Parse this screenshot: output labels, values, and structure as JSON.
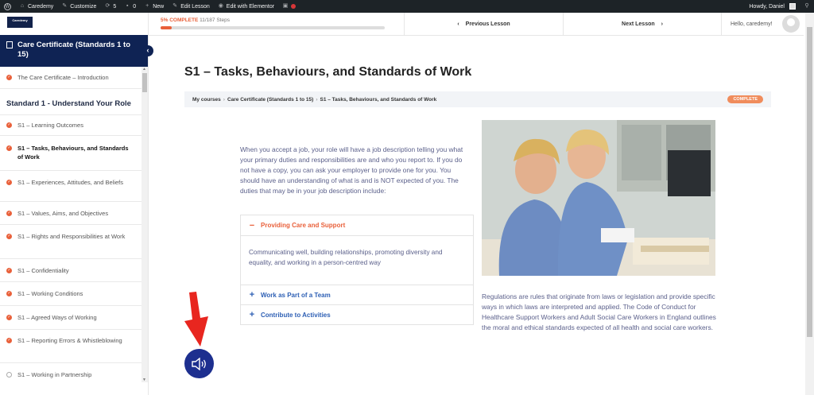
{
  "adminbar": {
    "site": "Caredemy",
    "customize": "Customize",
    "updates": "5",
    "comments": "0",
    "new": "New",
    "edit_lesson": "Edit Lesson",
    "edit_elementor": "Edit with Elementor",
    "howdy": "Howdy, Daniel"
  },
  "sidebar": {
    "logo": "Caredemy",
    "course_title": "Care Certificate (Standards 1 to 15)",
    "items_top": [
      {
        "label": "The Care Certificate – Introduction",
        "done": true
      }
    ],
    "section": "Standard 1 - Understand Your Role",
    "items": [
      {
        "label": "S1 – Learning Outcomes",
        "done": true
      },
      {
        "label": "S1 – Tasks, Behaviours, and Standards of Work",
        "done": true,
        "active": true
      },
      {
        "label": "S1 – Experiences, Attitudes, and Beliefs",
        "done": true
      },
      {
        "label": "S1 – Values, Aims, and Objectives",
        "done": true
      },
      {
        "label": "S1 – Rights and Responsibilities at Work",
        "done": true
      },
      {
        "label": "S1 – Confidentiality",
        "done": true
      },
      {
        "label": "S1 – Working Conditions",
        "done": true
      },
      {
        "label": "S1 – Agreed Ways of Working",
        "done": true
      },
      {
        "label": "S1 – Reporting Errors & Whistleblowing",
        "done": true
      },
      {
        "label": "S1 – Working in Partnership",
        "done": false
      }
    ]
  },
  "topbar": {
    "progress_label": "5% COMPLETE",
    "progress_steps": "11/187 Steps",
    "progress_fraction": 0.05,
    "prev": "Previous Lesson",
    "next": "Next Lesson",
    "hello": "Hello, caredemy!"
  },
  "lesson": {
    "title": "S1 – Tasks, Behaviours, and Standards of Work",
    "breadcrumbs": [
      "My courses",
      "Care Certificate (Standards 1 to 15)",
      "S1 – Tasks, Behaviours, and Standards of Work"
    ],
    "status": "COMPLETE",
    "intro": "When you accept a job, your role will have a job description telling you what your primary duties and responsibilities are and who you report to. If you do not have a copy, you can ask your employer to provide one for you. You should have an understanding of what is and is NOT expected of you. The duties that may be in your job description include:",
    "accordion": [
      {
        "title": "Providing Care and Support",
        "open": true,
        "body": "Communicating well, building relationships, promoting diversity and equality, and working in a person-centred way"
      },
      {
        "title": "Work as Part of a Team",
        "open": false
      },
      {
        "title": "Contribute to Activities",
        "open": false
      }
    ],
    "regulations": "Regulations are rules that originate from laws or legislation and provide specific ways in which laws are interpreted and applied. The Code of Conduct for Healthcare Support Workers and Adult Social Care Workers in England outlines the moral and ethical standards expected of all health and social care workers."
  },
  "colors": {
    "accent": "#e9603a",
    "navy": "#0f2354",
    "link": "#2d5fb4",
    "text": "#5a5f8a"
  }
}
